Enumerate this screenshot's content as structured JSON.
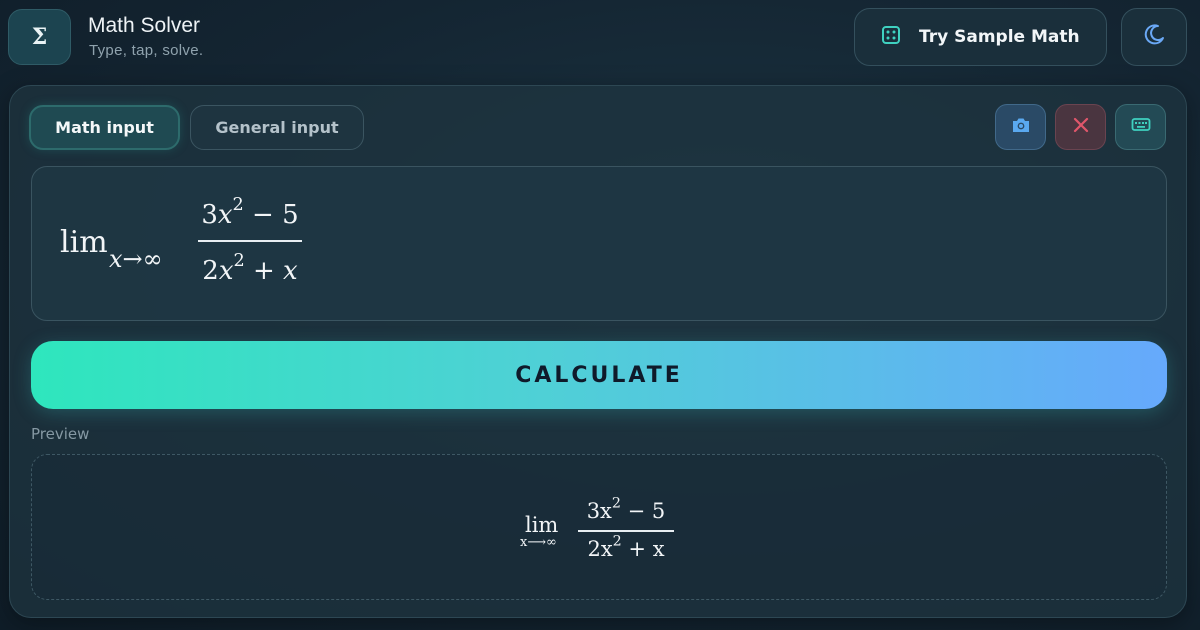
{
  "app": {
    "logo_symbol": "Σ",
    "title": "Math Solver",
    "subtitle": "Type, tap, solve."
  },
  "header": {
    "sample_button_label": "Try Sample Math",
    "sample_icon": "dice-icon",
    "theme_icon": "moon-icon"
  },
  "tabs": [
    {
      "label": "Math input",
      "active": true
    },
    {
      "label": "General input",
      "active": false
    }
  ],
  "tools": [
    {
      "name": "camera-icon",
      "color": "#5aa9f0"
    },
    {
      "name": "close-icon",
      "color": "#e0566b"
    },
    {
      "name": "keyboard-icon",
      "color": "#3fd1c0"
    }
  ],
  "expression": {
    "operator": "lim",
    "subscript_var": "x",
    "subscript_arrow": "→",
    "subscript_target": "∞",
    "numerator": {
      "coef": "3",
      "var": "x",
      "exp": "2",
      "rest": " − 5"
    },
    "denominator": {
      "coef": "2",
      "var": "x",
      "exp": "2",
      "rest": " + x"
    }
  },
  "calculate_label": "CALCULATE",
  "preview": {
    "label": "Preview",
    "operator": "lim",
    "subscript": "x⟶∞",
    "numerator": {
      "coef": "3x",
      "exp": "2",
      "rest": " − 5"
    },
    "denominator": {
      "coef": "2x",
      "exp": "2",
      "rest": " + x"
    }
  },
  "colors": {
    "accent_start": "#2ee6bd",
    "accent_end": "#66a9fc",
    "background": "#142532"
  }
}
